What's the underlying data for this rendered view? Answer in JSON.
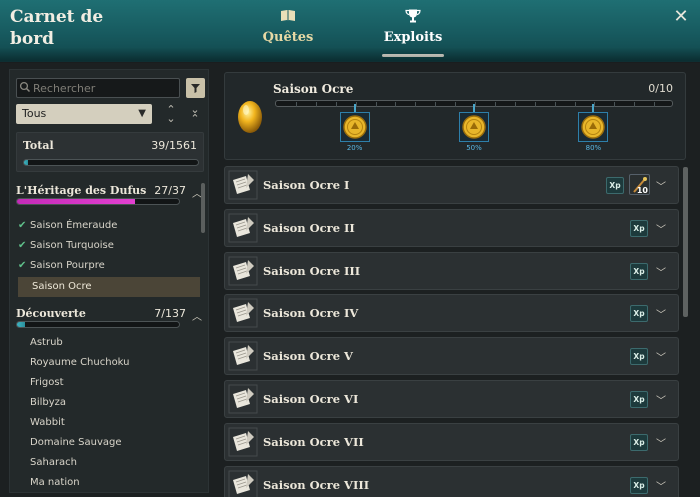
{
  "window": {
    "title": "Carnet de bord",
    "tabs": [
      {
        "label": "Quêtes",
        "icon": "book-icon",
        "active": false
      },
      {
        "label": "Exploits",
        "icon": "trophy-icon",
        "active": true
      }
    ],
    "close_icon": "close-icon"
  },
  "sidebar": {
    "search_placeholder": "Rechercher",
    "filter_icon": "funnel-icon",
    "select_value": "Tous",
    "total": {
      "label": "Total",
      "count": "39/1561",
      "progress": 0.025
    },
    "categories": [
      {
        "title": "L'Héritage des Dufus",
        "count": "27/37",
        "progress": 0.73,
        "expanded": true,
        "items": [
          {
            "label": "Saison Émeraude",
            "completed": true
          },
          {
            "label": "Saison Turquoise",
            "completed": true
          },
          {
            "label": "Saison Pourpre",
            "completed": true
          },
          {
            "label": "Saison Ocre",
            "completed": false,
            "selected": true
          }
        ]
      },
      {
        "title": "Découverte",
        "count": "7/137",
        "progress": 0.05,
        "expanded": true,
        "items": [
          {
            "label": "Astrub"
          },
          {
            "label": "Royaume Chuchoku"
          },
          {
            "label": "Frigost"
          },
          {
            "label": "Bilbyza"
          },
          {
            "label": "Wabbit"
          },
          {
            "label": "Domaine Sauvage"
          },
          {
            "label": "Saharach"
          },
          {
            "label": "Ma nation"
          }
        ]
      }
    ]
  },
  "season": {
    "title": "Saison Ocre",
    "count": "0/10",
    "progress": 0,
    "rewards": [
      {
        "pct": "20%",
        "at": 0.2,
        "icon": "gold-coin-icon"
      },
      {
        "pct": "50%",
        "at": 0.5,
        "icon": "gold-coin-icon"
      },
      {
        "pct": "80%",
        "at": 0.8,
        "icon": "gold-coin-icon"
      }
    ]
  },
  "achievements": [
    {
      "title": "Saison Ocre I",
      "xp": "Xp",
      "item_qty": "10"
    },
    {
      "title": "Saison Ocre II",
      "xp": "Xp"
    },
    {
      "title": "Saison Ocre III",
      "xp": "Xp"
    },
    {
      "title": "Saison Ocre IV",
      "xp": "Xp"
    },
    {
      "title": "Saison Ocre V",
      "xp": "Xp"
    },
    {
      "title": "Saison Ocre VI",
      "xp": "Xp"
    },
    {
      "title": "Saison Ocre VII",
      "xp": "Xp"
    },
    {
      "title": "Saison Ocre VIII",
      "xp": "Xp"
    }
  ],
  "colors": {
    "header": "#1a6468",
    "accent_pink": "#d63cc6",
    "accent_teal": "#3fb6c3",
    "pct_blue": "#5ab8e6"
  }
}
